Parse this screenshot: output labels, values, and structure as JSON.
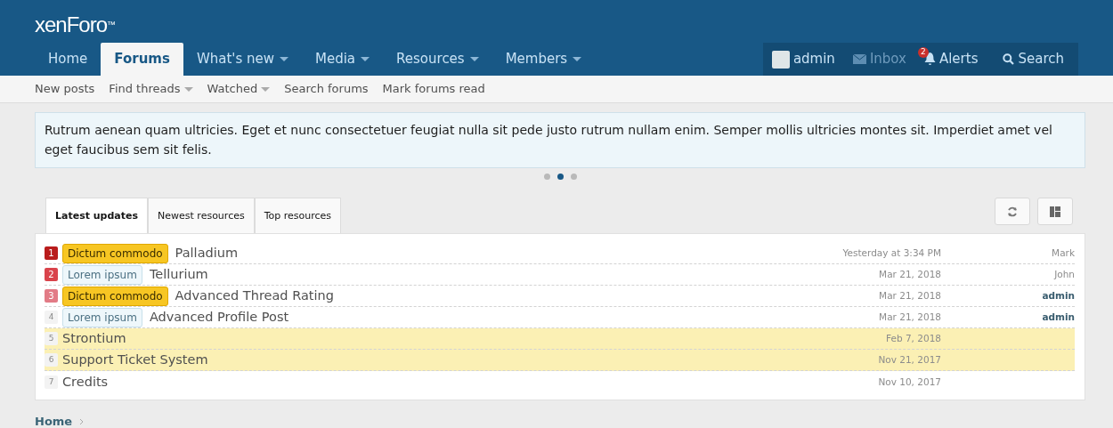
{
  "logo": "xenForo",
  "logo_mark": "™",
  "nav": [
    {
      "label": "Home",
      "selected": false,
      "dropdown": false
    },
    {
      "label": "Forums",
      "selected": true,
      "dropdown": false
    },
    {
      "label": "What's new",
      "selected": false,
      "dropdown": true
    },
    {
      "label": "Media",
      "selected": false,
      "dropdown": true
    },
    {
      "label": "Resources",
      "selected": false,
      "dropdown": true
    },
    {
      "label": "Members",
      "selected": false,
      "dropdown": true
    }
  ],
  "account": {
    "username": "admin",
    "inbox": "Inbox",
    "alerts": "Alerts",
    "alerts_count": "2",
    "search": "Search"
  },
  "subnav": [
    {
      "label": "New posts",
      "dropdown": false
    },
    {
      "label": "Find threads",
      "dropdown": true
    },
    {
      "label": "Watched",
      "dropdown": true
    },
    {
      "label": "Search forums",
      "dropdown": false
    },
    {
      "label": "Mark forums read",
      "dropdown": false
    }
  ],
  "notice": {
    "text": "Rutrum aenean quam ultricies. Eget et nunc consectetuer feugiat nulla sit pede justo rutrum nullam enim. Semper mollis ultricies montes sit. Imperdiet amet vel eget faucibus sem sit felis.",
    "dots": [
      {
        "selected": false
      },
      {
        "selected": true
      },
      {
        "selected": false
      }
    ]
  },
  "tabs": [
    {
      "label": "Latest updates",
      "selected": true
    },
    {
      "label": "Newest resources",
      "selected": false
    },
    {
      "label": "Top resources",
      "selected": false
    }
  ],
  "resources": [
    {
      "rank": "1",
      "color": "#b91c1c",
      "prefix": {
        "text": "Dictum commodo",
        "kind": "warning"
      },
      "title": "Palladium",
      "date": "Yesterday at 3:34 PM",
      "author": "Mark",
      "author_bold": false,
      "highlighted": false
    },
    {
      "rank": "2",
      "color": "#d9434b",
      "prefix": {
        "text": "Lorem ipsum",
        "kind": "info"
      },
      "title": "Tellurium",
      "date": "Mar 21, 2018",
      "author": "John",
      "author_bold": false,
      "highlighted": false
    },
    {
      "rank": "3",
      "color": "#e27b86",
      "prefix": {
        "text": "Dictum commodo",
        "kind": "warning"
      },
      "title": "Advanced Thread Rating",
      "date": "Mar 21, 2018",
      "author": "admin",
      "author_bold": true,
      "highlighted": false
    },
    {
      "rank": "4",
      "prefix": {
        "text": "Lorem ipsum",
        "kind": "info"
      },
      "title": "Advanced Profile Post",
      "date": "Mar 21, 2018",
      "author": "admin",
      "author_bold": true,
      "highlighted": false
    },
    {
      "rank": "5",
      "title": "Strontium",
      "date": "Feb 7, 2018",
      "highlighted": true
    },
    {
      "rank": "6",
      "title": "Support Ticket System",
      "date": "Nov 21, 2017",
      "highlighted": true
    },
    {
      "rank": "7",
      "title": "Credits",
      "date": "Nov 10, 2017",
      "highlighted": false
    }
  ],
  "breadcrumb": [
    {
      "label": "Home"
    }
  ]
}
